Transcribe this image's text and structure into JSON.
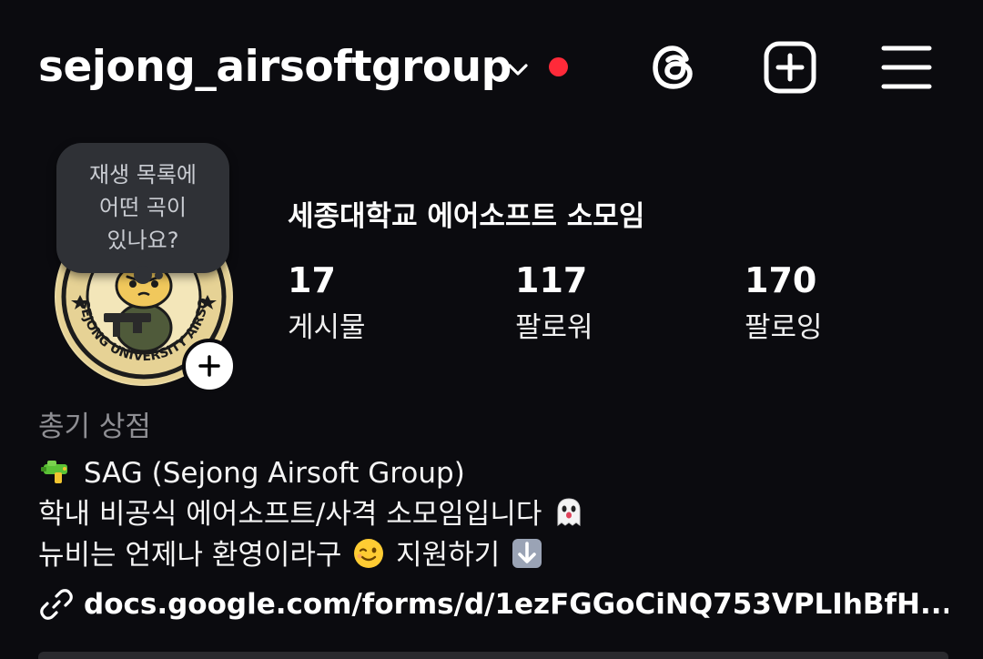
{
  "header": {
    "username": "sejong_airsoftgroup",
    "icons": {
      "chevron": "chevron-down-icon",
      "threads": "threads-icon",
      "create": "plus-square-icon",
      "menu": "hamburger-menu-icon"
    },
    "notification_dot_color": "#ff2a39"
  },
  "profile": {
    "note_lines": [
      "재생 목록에",
      "어떤 곡이",
      "있나요?"
    ],
    "display_name": "세종대학교 에어소프트 소모임",
    "stats": [
      {
        "value": "17",
        "label": "게시물"
      },
      {
        "value": "117",
        "label": "팔로워"
      },
      {
        "value": "170",
        "label": "팔로잉"
      }
    ],
    "avatar_text": "SEJONG UNIVERSITY AIRSOFT TEAM"
  },
  "bio": {
    "category": "총기 상점",
    "line1": "SAG (Sejong Airsoft Group)",
    "line2": "학내 비공식 에어소프트/사격 소모임입니다",
    "line3a": "뉴비는 언제나 환영이라구",
    "line3b": "지원하기",
    "link": "docs.google.com/forms/d/1ezFGGoCiNQ753VPLIhBfH..."
  }
}
